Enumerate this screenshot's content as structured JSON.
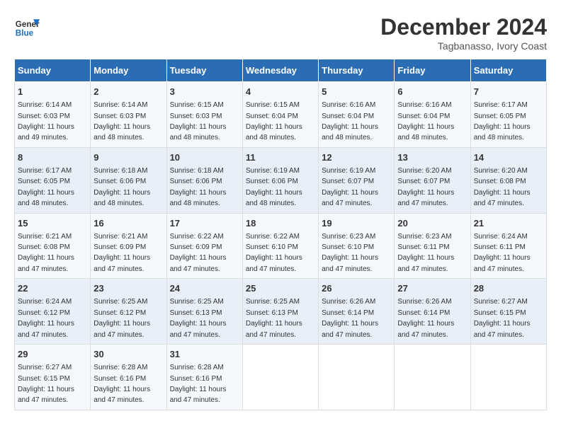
{
  "logo": {
    "line1": "General",
    "line2": "Blue"
  },
  "title": "December 2024",
  "subtitle": "Tagbanasso, Ivory Coast",
  "days_of_week": [
    "Sunday",
    "Monday",
    "Tuesday",
    "Wednesday",
    "Thursday",
    "Friday",
    "Saturday"
  ],
  "weeks": [
    [
      {
        "day": 1,
        "sunrise": "6:14 AM",
        "sunset": "6:03 PM",
        "daylight": "11 hours and 49 minutes."
      },
      {
        "day": 2,
        "sunrise": "6:14 AM",
        "sunset": "6:03 PM",
        "daylight": "11 hours and 48 minutes."
      },
      {
        "day": 3,
        "sunrise": "6:15 AM",
        "sunset": "6:03 PM",
        "daylight": "11 hours and 48 minutes."
      },
      {
        "day": 4,
        "sunrise": "6:15 AM",
        "sunset": "6:04 PM",
        "daylight": "11 hours and 48 minutes."
      },
      {
        "day": 5,
        "sunrise": "6:16 AM",
        "sunset": "6:04 PM",
        "daylight": "11 hours and 48 minutes."
      },
      {
        "day": 6,
        "sunrise": "6:16 AM",
        "sunset": "6:04 PM",
        "daylight": "11 hours and 48 minutes."
      },
      {
        "day": 7,
        "sunrise": "6:17 AM",
        "sunset": "6:05 PM",
        "daylight": "11 hours and 48 minutes."
      }
    ],
    [
      {
        "day": 8,
        "sunrise": "6:17 AM",
        "sunset": "6:05 PM",
        "daylight": "11 hours and 48 minutes."
      },
      {
        "day": 9,
        "sunrise": "6:18 AM",
        "sunset": "6:06 PM",
        "daylight": "11 hours and 48 minutes."
      },
      {
        "day": 10,
        "sunrise": "6:18 AM",
        "sunset": "6:06 PM",
        "daylight": "11 hours and 48 minutes."
      },
      {
        "day": 11,
        "sunrise": "6:19 AM",
        "sunset": "6:06 PM",
        "daylight": "11 hours and 48 minutes."
      },
      {
        "day": 12,
        "sunrise": "6:19 AM",
        "sunset": "6:07 PM",
        "daylight": "11 hours and 47 minutes."
      },
      {
        "day": 13,
        "sunrise": "6:20 AM",
        "sunset": "6:07 PM",
        "daylight": "11 hours and 47 minutes."
      },
      {
        "day": 14,
        "sunrise": "6:20 AM",
        "sunset": "6:08 PM",
        "daylight": "11 hours and 47 minutes."
      }
    ],
    [
      {
        "day": 15,
        "sunrise": "6:21 AM",
        "sunset": "6:08 PM",
        "daylight": "11 hours and 47 minutes."
      },
      {
        "day": 16,
        "sunrise": "6:21 AM",
        "sunset": "6:09 PM",
        "daylight": "11 hours and 47 minutes."
      },
      {
        "day": 17,
        "sunrise": "6:22 AM",
        "sunset": "6:09 PM",
        "daylight": "11 hours and 47 minutes."
      },
      {
        "day": 18,
        "sunrise": "6:22 AM",
        "sunset": "6:10 PM",
        "daylight": "11 hours and 47 minutes."
      },
      {
        "day": 19,
        "sunrise": "6:23 AM",
        "sunset": "6:10 PM",
        "daylight": "11 hours and 47 minutes."
      },
      {
        "day": 20,
        "sunrise": "6:23 AM",
        "sunset": "6:11 PM",
        "daylight": "11 hours and 47 minutes."
      },
      {
        "day": 21,
        "sunrise": "6:24 AM",
        "sunset": "6:11 PM",
        "daylight": "11 hours and 47 minutes."
      }
    ],
    [
      {
        "day": 22,
        "sunrise": "6:24 AM",
        "sunset": "6:12 PM",
        "daylight": "11 hours and 47 minutes."
      },
      {
        "day": 23,
        "sunrise": "6:25 AM",
        "sunset": "6:12 PM",
        "daylight": "11 hours and 47 minutes."
      },
      {
        "day": 24,
        "sunrise": "6:25 AM",
        "sunset": "6:13 PM",
        "daylight": "11 hours and 47 minutes."
      },
      {
        "day": 25,
        "sunrise": "6:25 AM",
        "sunset": "6:13 PM",
        "daylight": "11 hours and 47 minutes."
      },
      {
        "day": 26,
        "sunrise": "6:26 AM",
        "sunset": "6:14 PM",
        "daylight": "11 hours and 47 minutes."
      },
      {
        "day": 27,
        "sunrise": "6:26 AM",
        "sunset": "6:14 PM",
        "daylight": "11 hours and 47 minutes."
      },
      {
        "day": 28,
        "sunrise": "6:27 AM",
        "sunset": "6:15 PM",
        "daylight": "11 hours and 47 minutes."
      }
    ],
    [
      {
        "day": 29,
        "sunrise": "6:27 AM",
        "sunset": "6:15 PM",
        "daylight": "11 hours and 47 minutes."
      },
      {
        "day": 30,
        "sunrise": "6:28 AM",
        "sunset": "6:16 PM",
        "daylight": "11 hours and 47 minutes."
      },
      {
        "day": 31,
        "sunrise": "6:28 AM",
        "sunset": "6:16 PM",
        "daylight": "11 hours and 47 minutes."
      },
      null,
      null,
      null,
      null
    ]
  ]
}
